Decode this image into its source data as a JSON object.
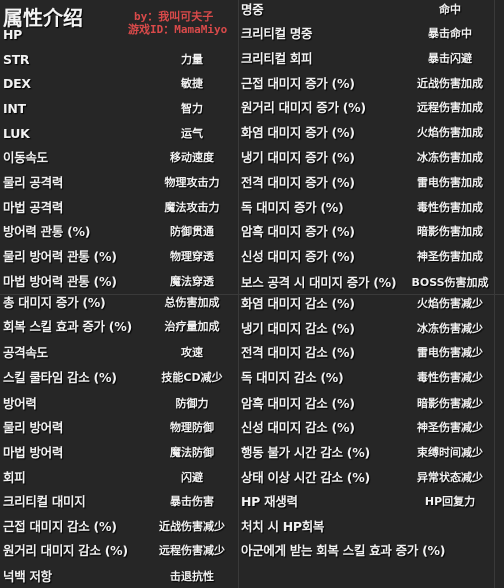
{
  "title": "属性介绍",
  "credit": {
    "line1": "by：我叫可夫子",
    "line2": "游戏ID：MamaMiyo"
  },
  "colors": {
    "background": "#262626",
    "text": "#f2f2f2",
    "credit": "#d94a4a"
  },
  "left": [
    {
      "ko": "HP",
      "zh": ""
    },
    {
      "ko": "STR",
      "zh": "力量"
    },
    {
      "ko": "DEX",
      "zh": "敏捷"
    },
    {
      "ko": "INT",
      "zh": "智力"
    },
    {
      "ko": "LUK",
      "zh": "运气"
    },
    {
      "ko": "이동속도",
      "zh": "移动速度"
    },
    {
      "ko": "물리 공격력",
      "zh": "物理攻击力"
    },
    {
      "ko": "마법 공격력",
      "zh": "魔法攻击力"
    },
    {
      "ko": "방어력 관통 (%)",
      "zh": "防御贯通"
    },
    {
      "ko": "물리 방어력 관통 (%)",
      "zh": "物理穿透"
    },
    {
      "ko": "마법 방어력 관통 (%)",
      "zh": "魔法穿透"
    },
    {
      "ko": "총 대미지 증가 (%)",
      "zh": "总伤害加成"
    },
    {
      "ko": "회복 스킬 효과 증가 (%)",
      "zh": "治疗量加成"
    },
    {
      "ko": "공격속도",
      "zh": "攻速"
    },
    {
      "ko": "스킬 쿨타임 감소 (%)",
      "zh": "技能CD减少"
    },
    {
      "ko": "방어력",
      "zh": "防御力"
    },
    {
      "ko": "물리 방어력",
      "zh": "物理防御"
    },
    {
      "ko": "마법 방어력",
      "zh": "魔法防御"
    },
    {
      "ko": "회피",
      "zh": "闪避"
    },
    {
      "ko": "크리티컬 대미지",
      "zh": "暴击伤害"
    },
    {
      "ko": "근접 대미지 감소 (%)",
      "zh": "近战伤害减少"
    },
    {
      "ko": "원거리 대미지 감소 (%)",
      "zh": "远程伤害减少"
    },
    {
      "ko": "넉백 저항",
      "zh": "击退抗性"
    }
  ],
  "right": [
    {
      "ko": "명중",
      "zh": "命中"
    },
    {
      "ko": "크리티컬 명중",
      "zh": "暴击命中"
    },
    {
      "ko": "크리티컬 회피",
      "zh": "暴击闪避"
    },
    {
      "ko": "근접 대미지 증가 (%)",
      "zh": "近战伤害加成"
    },
    {
      "ko": "원거리 대미지 증가 (%)",
      "zh": "远程伤害加成"
    },
    {
      "ko": "화염 대미지 증가 (%)",
      "zh": "火焰伤害加成"
    },
    {
      "ko": "냉기 대미지 증가 (%)",
      "zh": "冰冻伤害加成"
    },
    {
      "ko": "전격 대미지 증가 (%)",
      "zh": "雷电伤害加成"
    },
    {
      "ko": "독 대미지 증가 (%)",
      "zh": "毒性伤害加成"
    },
    {
      "ko": "암흑 대미지 증가 (%)",
      "zh": "暗影伤害加成"
    },
    {
      "ko": "신성 대미지 증가 (%)",
      "zh": "神圣伤害加成"
    },
    {
      "ko": "보스 공격 시 대미지 증가 (%)",
      "zh": "BOSS伤害加成"
    },
    {
      "ko": "화염 대미지 감소 (%)",
      "zh": "火焰伤害减少"
    },
    {
      "ko": "냉기 대미지 감소 (%)",
      "zh": "冰冻伤害减少"
    },
    {
      "ko": "전격 대미지 감소 (%)",
      "zh": "雷电伤害减少"
    },
    {
      "ko": "독 대미지 감소 (%)",
      "zh": "毒性伤害减少"
    },
    {
      "ko": "암흑 대미지 감소 (%)",
      "zh": "暗影伤害减少"
    },
    {
      "ko": "신성 대미지 감소 (%)",
      "zh": "神圣伤害减少"
    },
    {
      "ko": "행동 불가 시간 감소 (%)",
      "zh": "束缚时间减少"
    },
    {
      "ko": "상태 이상 시간 감소 (%)",
      "zh": "异常状态减少"
    },
    {
      "ko": "HP 재생력",
      "zh": "HP回复力"
    },
    {
      "ko": "처치 시 HP회복",
      "zh": ""
    },
    {
      "ko": "아군에게 받는 회복 스킬 효과 증가 (%)",
      "zh": ""
    }
  ]
}
